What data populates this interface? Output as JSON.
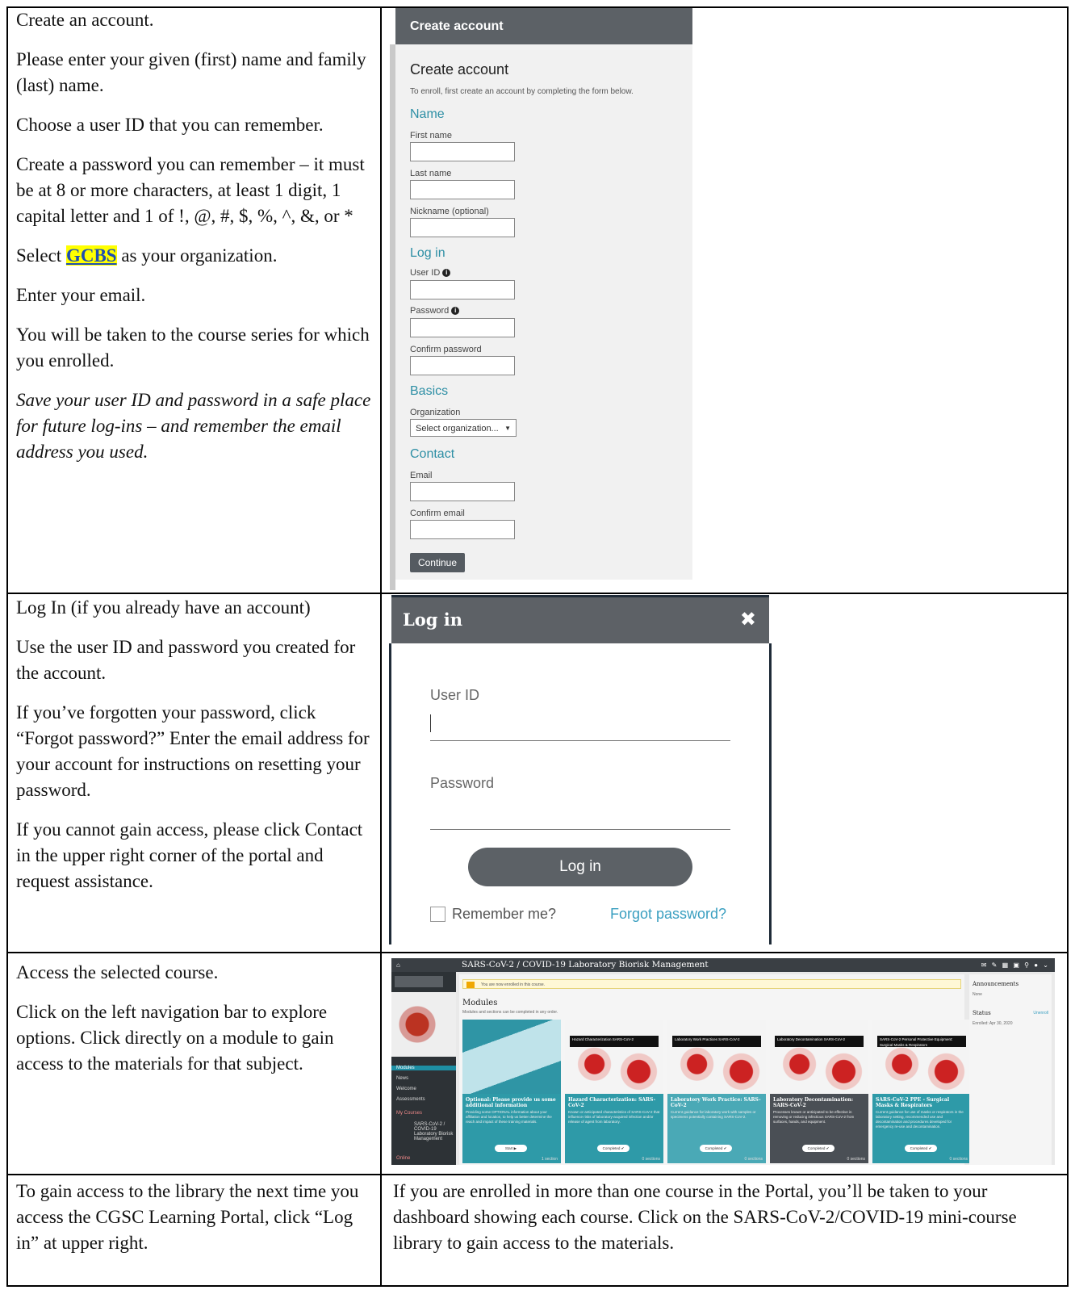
{
  "rows": [
    {
      "left": [
        "Create an account.",
        "Please enter your given (first) name and family (last) name.",
        "Choose a user ID that you can remember.",
        "Create a password you can remember – it must be at 8 or more characters, at least 1 digit, 1 capital letter and 1 of !, @, #, $, %, ^, &, or *",
        {
          "pre": "Select ",
          "highlight": "GCBS",
          "post": " as your organization."
        },
        "Enter your email.",
        "You will be taken to the course series for which you enrolled.",
        "Save your user ID and password in a safe place for future log-ins – and remember the email address you used."
      ]
    },
    {
      "left": [
        "Log In (if you already have an account)",
        "Use the user ID and password you created for the account.",
        "If you’ve forgotten your password, click “Forgot password?” Enter the email address for your account for instructions on resetting your password.",
        "If you cannot gain access, please click Contact in the upper right corner of the portal and request assistance."
      ]
    },
    {
      "left": [
        "Access the selected course.",
        "Click on the left navigation bar to explore options. Click directly on a module to gain access to the materials for that subject."
      ]
    },
    {
      "left": [
        "To gain access to the library the next time you access the CGSC Learning Portal, click “Log in” at upper right."
      ],
      "right": "If you are enrolled in more than one course in the Portal, you’ll be taken to your dashboard showing each course.  Click on the SARS-CoV-2/COVID-19 mini-course library to gain access to the materials."
    }
  ],
  "create_account": {
    "header": "Create account",
    "title": "Create account",
    "intro": "To enroll, first create an account by completing the form below.",
    "sections": {
      "name": "Name",
      "login": "Log in",
      "basics": "Basics",
      "contact": "Contact"
    },
    "labels": {
      "first_name": "First name",
      "last_name": "Last name",
      "nickname": "Nickname (optional)",
      "user_id": "User ID",
      "password": "Password",
      "confirm_password": "Confirm password",
      "organization": "Organization",
      "email": "Email",
      "confirm_email": "Confirm email"
    },
    "organization_select": "Select organization...",
    "continue": "Continue"
  },
  "login_modal": {
    "title": "Log in",
    "close": "✖",
    "user_id": "User ID",
    "password": "Password",
    "button": "Log in",
    "remember": "Remember me?",
    "forgot": "Forgot password?"
  },
  "course": {
    "title": "SARS-CoV-2 / COVID-19 Laboratory Biorisk Management",
    "banner": "You are now enrolled in this course.",
    "modules_heading": "Modules",
    "modules_sub": "Modules and sections can be completed in any order.",
    "nav": [
      "Modules",
      "News",
      "Welcome",
      "Assessments"
    ],
    "my_courses": "My Courses",
    "my_course_item": "SARS-CoV-2 / COVID-19 Laboratory Biorisk Management",
    "online": "Online",
    "cards": [
      {
        "caption": "",
        "title": "Optional: Please provide us some additional information",
        "desc": "Providing some OPTIONAL information about your affiliation and location, to help us better determine the reach and impact of these training materials.",
        "button": "Start ▶",
        "footer": "1 section",
        "color": "#2e9aa8"
      },
      {
        "caption": "Hazard Characterization SARS-CoV-2",
        "title": "Hazard Characterization: SARS-CoV-2",
        "desc": "Known or anticipated characteristics of SARS-CoV-2 that influence risks of laboratory-acquired infection and/or release of agent from laboratory.",
        "button": "Completed ✔",
        "footer": "0 sections",
        "color": "#2e9aa8"
      },
      {
        "caption": "Laboratory Work Practices SARS-CoV-2",
        "title": "Laboratory Work Practice: SARS-CoV-2",
        "desc": "Current guidance for laboratory work with samples or specimens potentially containing SARS-CoV-2.",
        "button": "Completed ✔",
        "footer": "0 sections",
        "color": "#4aa9b6"
      },
      {
        "caption": "Laboratory Decontamination SARS-CoV-2",
        "title": "Laboratory Decontamination: SARS-CoV-2",
        "desc": "Processes known or anticipated to be effective in removing or reducing infectious SARS-CoV-2 from surfaces, hands, and equipment.",
        "button": "Completed ✔",
        "footer": "0 sections",
        "color": "#4a4f55"
      },
      {
        "caption": "SARS-CoV-2 Personal Protective Equipment: Surgical Masks & Respirators",
        "title": "SARS-CoV-2 PPE - Surgical Masks & Respirators",
        "desc": "Current guidance for use of masks or respirators in the laboratory setting, recommended use and decontamination and procedures developed for emergency re-use and decontamination.",
        "button": "Completed ✔",
        "footer": "0 sections",
        "color": "#2e9aa8"
      }
    ],
    "announcements": "Announcements",
    "announcements_none": "None",
    "status": "Status",
    "unenroll": "Unenroll",
    "enrolled": "Enrolled: Apr 30, 2020"
  }
}
